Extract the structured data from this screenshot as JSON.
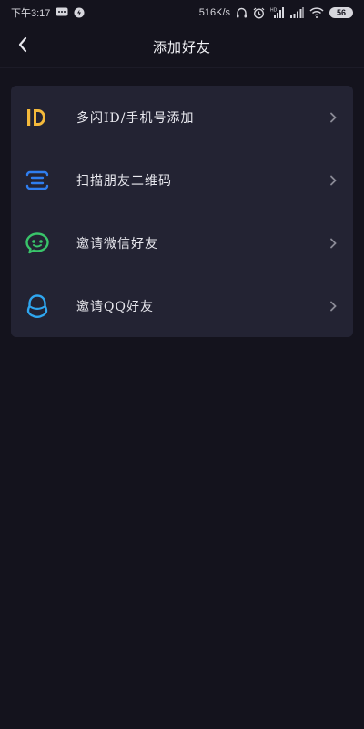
{
  "status_bar": {
    "time": "下午3:17",
    "speed": "516K/s",
    "battery": "56",
    "icons": [
      "message-icon",
      "shield-icon",
      "headphones-icon",
      "alarm-icon",
      "hd-signal-icon",
      "signal-icon",
      "wifi-icon",
      "battery-icon"
    ]
  },
  "header": {
    "title": "添加好友",
    "back_icon": "chevron-left-icon"
  },
  "menu": {
    "items": [
      {
        "label": "多闪ID/手机号添加",
        "icon": "id-icon",
        "color": "#f4b93b"
      },
      {
        "label": "扫描朋友二维码",
        "icon": "scan-qr-icon",
        "color": "#2f7ef0"
      },
      {
        "label": "邀请微信好友",
        "icon": "wechat-icon",
        "color": "#39c46a"
      },
      {
        "label": "邀请QQ好友",
        "icon": "qq-icon",
        "color": "#2fa6ef"
      }
    ]
  },
  "colors": {
    "background": "#14131d",
    "card": "#232333",
    "chevron": "#8a8a96"
  }
}
